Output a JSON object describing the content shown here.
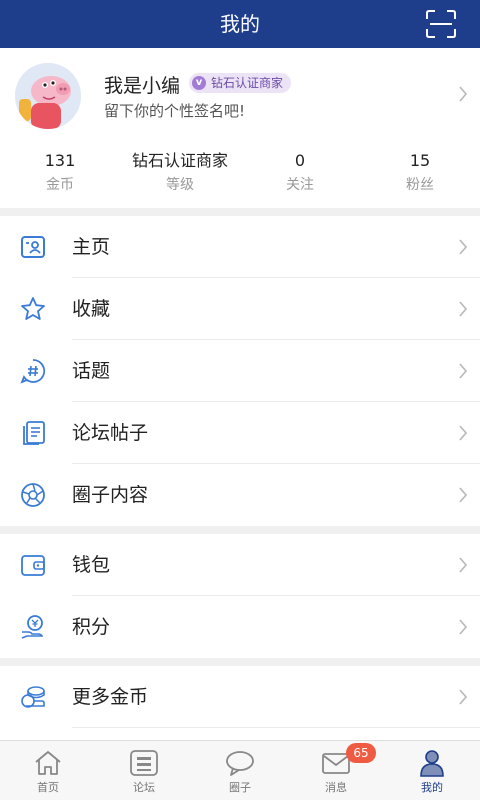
{
  "header": {
    "title": "我的"
  },
  "profile": {
    "name": "我是小编",
    "badge": "钻石认证商家",
    "badge_icon_letter": "v",
    "signature": "留下你的个性签名吧!"
  },
  "stats": [
    {
      "value": "131",
      "label": "金币"
    },
    {
      "value": "钻石认证商家",
      "label": "等级"
    },
    {
      "value": "0",
      "label": "关注"
    },
    {
      "value": "15",
      "label": "粉丝"
    }
  ],
  "menu": [
    {
      "label": "主页",
      "icon": "profile-card-icon"
    },
    {
      "label": "收藏",
      "icon": "star-icon"
    },
    {
      "label": "话题",
      "icon": "hashtag-icon"
    },
    {
      "label": "论坛帖子",
      "icon": "document-icon"
    },
    {
      "label": "圈子内容",
      "icon": "aperture-icon"
    }
  ],
  "menu2": [
    {
      "label": "钱包",
      "icon": "wallet-icon"
    },
    {
      "label": "积分",
      "icon": "points-icon"
    }
  ],
  "menu3": [
    {
      "label": "更多金币",
      "icon": "coins-icon"
    }
  ],
  "tabs": [
    {
      "label": "首页",
      "icon": "home-icon"
    },
    {
      "label": "论坛",
      "icon": "forum-icon"
    },
    {
      "label": "圈子",
      "icon": "chat-bubble-icon"
    },
    {
      "label": "消息",
      "icon": "envelope-icon",
      "badge": "65"
    },
    {
      "label": "我的",
      "icon": "user-icon",
      "active": true
    }
  ],
  "colors": {
    "header": "#1e3d8a",
    "icon": "#3a7bd5",
    "badge_bg": "#ece3f7",
    "badge_text": "#6b4aa6",
    "message_badge": "#ef5a42"
  }
}
